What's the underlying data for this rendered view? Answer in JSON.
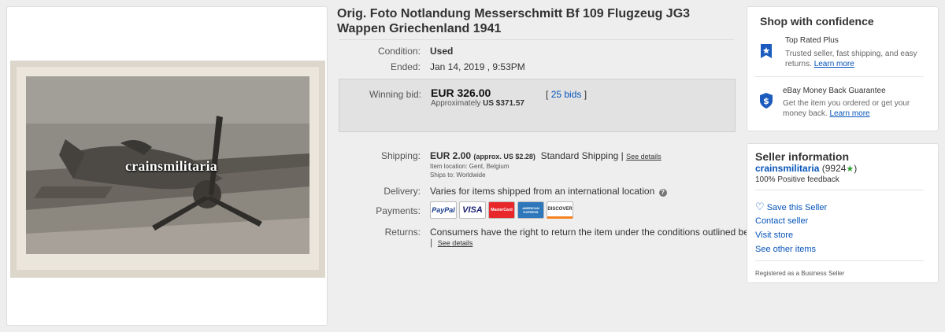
{
  "listing": {
    "title": "Orig. Foto Notlandung Messerschmitt Bf 109 Flugzeug JG3 Wappen Griechenland 1941",
    "watermark": "crainsmilitaria"
  },
  "details": {
    "condition_label": "Condition:",
    "condition_value": "Used",
    "ended_label": "Ended:",
    "ended_value": "Jan 14, 2019 , 9:53PM"
  },
  "bid": {
    "label": "Winning bid:",
    "amount": "EUR 326.00",
    "approx_prefix": "Approximately",
    "approx_value": "US $371.57",
    "bids_open": "[",
    "bids_count": "25 bids",
    "bids_close": "]"
  },
  "shipping": {
    "label": "Shipping:",
    "amount": "EUR 2.00",
    "approx": "(approx. US $2.28)",
    "method": "Standard Shipping |",
    "see_details": "See details",
    "location": "Item location:  Gent, Belgium",
    "ships_to": "Ships to:  Worldwide"
  },
  "delivery": {
    "label": "Delivery:",
    "value": "Varies for items shipped from an international location"
  },
  "payments": {
    "label": "Payments:",
    "logos": [
      "PayPal",
      "VISA",
      "MasterCard",
      "AMERICAN EXPRESS",
      "DISCOVER"
    ]
  },
  "returns": {
    "label": "Returns:",
    "value": "Consumers have the right to return the item under the conditions outlined below",
    "see_details": "See details"
  },
  "shop_confidence": {
    "title": "Shop with confidence",
    "item1_title": "Top Rated Plus",
    "item1_text_a": "Trusted seller, fast shipping, and easy",
    "item1_text_b": "returns.",
    "item1_link": "Learn more",
    "item2_title": "eBay Money Back Guarantee",
    "item2_text_a": "Get the item you ordered or get your",
    "item2_text_b": "money back.",
    "item2_link": "Learn more"
  },
  "seller": {
    "title": "Seller information",
    "name": "crainsmilitaria",
    "score": "(9924",
    "score_close": ")",
    "feedback": "100% Positive feedback",
    "save": "Save this Seller",
    "contact": "Contact seller",
    "visit": "Visit store",
    "other": "See other items",
    "business": "Registered as a Business Seller"
  },
  "colors": {
    "link": "#0654ba",
    "bidbox": "#e2e2e2",
    "star": "#2ca02c"
  }
}
